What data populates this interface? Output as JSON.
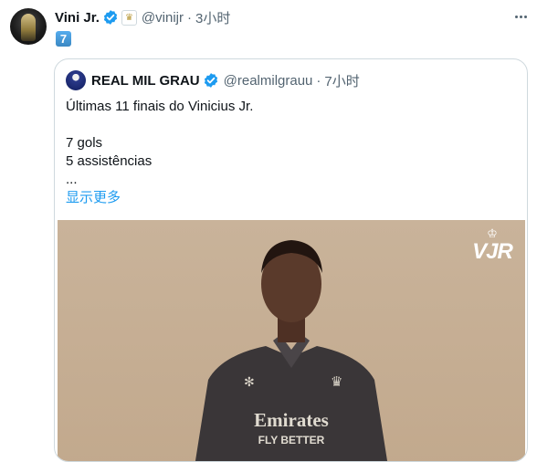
{
  "tweet": {
    "author_name": "Vini Jr.",
    "handle": "@vinijr",
    "separator": "·",
    "time": "3小时",
    "body_emoji": "7"
  },
  "quoted": {
    "author_name": "REAL MIL GRAU",
    "handle": "@realmilgrauu",
    "separator": "·",
    "time": "7小时",
    "lines": [
      "Últimas 11 finais do Vinicius Jr.",
      "",
      "7 gols",
      "5 assistências",
      "..."
    ],
    "show_more": "显示更多",
    "media": {
      "watermark": "VJR",
      "shirt_sponsor_line1": "Emirates",
      "shirt_sponsor_line2": "FLY BETTER"
    }
  },
  "colors": {
    "verified": "#1d9bf0",
    "link": "#1d9bf0",
    "muted": "#536471",
    "border": "#cfd9de"
  }
}
